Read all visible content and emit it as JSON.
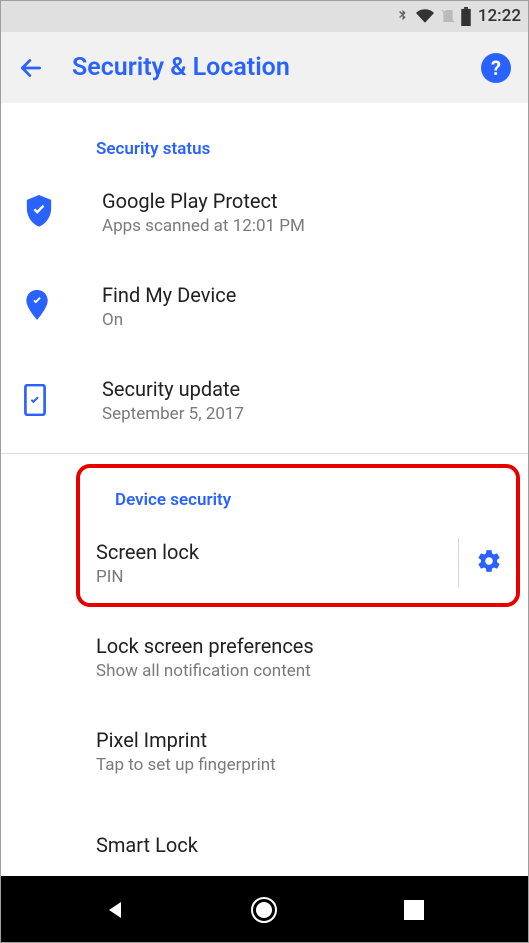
{
  "status": {
    "time": "12:22"
  },
  "appbar": {
    "title": "Security & Location"
  },
  "section1": {
    "header": "Security status",
    "item1": {
      "title": "Google Play Protect",
      "sub": "Apps scanned at 12:01 PM"
    },
    "item2": {
      "title": "Find My Device",
      "sub": "On"
    },
    "item3": {
      "title": "Security update",
      "sub": "September 5, 2017"
    }
  },
  "section2": {
    "header": "Device security",
    "item1": {
      "title": "Screen lock",
      "sub": "PIN"
    },
    "item2": {
      "title": "Lock screen preferences",
      "sub": "Show all notification content"
    },
    "item3": {
      "title": "Pixel Imprint",
      "sub": "Tap to set up fingerprint"
    },
    "item4": {
      "title": "Smart Lock"
    }
  }
}
